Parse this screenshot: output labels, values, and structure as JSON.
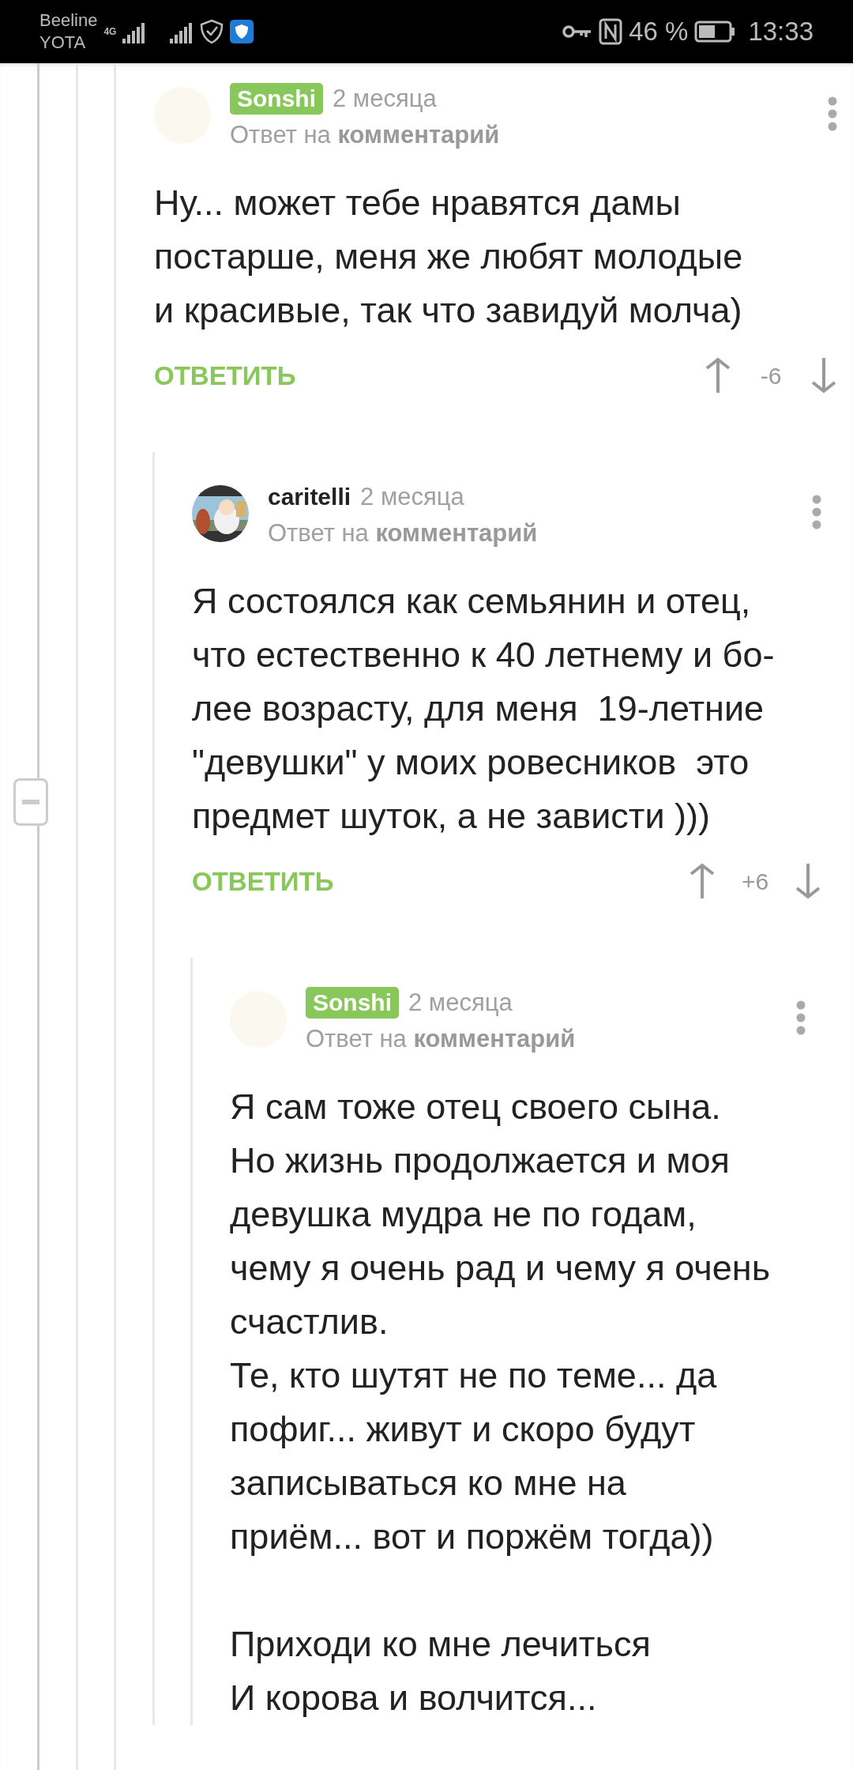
{
  "status_bar": {
    "carrier_top": "Beeline",
    "carrier_bottom": "YOTA",
    "network": "4G",
    "battery": "46 %",
    "time": "13:33"
  },
  "thread": {
    "expanded": true
  },
  "comment": {
    "author": "Sonshi",
    "author_badge": true,
    "avatar": {
      "kind": "blank"
    },
    "time": "2 месяца",
    "reply_to": "Ответ на **комментарий**",
    "body": "Ну... может тебе нравятся дамы\nпостарше, меня же любят молодые\nи красивые, так что завидуй молча)",
    "reply_label": "ОТВЕТИТЬ",
    "score": "-6",
    "children": [
      {
        "author": "caritelli",
        "author_badge": false,
        "time": "2 месяца",
        "reply_to": "Ответ на **комментарий**",
        "body": "Я состоялся как семьянин и отец,\nчто естественно к 40 летнему и бо-\nлее возрасту, для меня  19-летние\n\"девушки\" у моих ровесников  это\nпредмет шуток, а не зависти )))",
        "reply_label": "ОТВЕТИТЬ",
        "score": "+6",
        "children": [
          {
            "author": "Sonshi",
            "author_badge": true,
            "avatar": {
              "kind": "blank"
            },
            "time": "2 месяца",
            "reply_to": "Ответ на **комментарий**",
            "body": "Я сам тоже отец своего сына.\nНо жизнь продолжается и моя\nдевушка мудра не по годам,\nчему я очень рад и чему я очень\nсчастлив.\nТе, кто шутят не по теме... да\nпофиг... живут и скоро будут\nзаписываться ко мне на\nприём... вот и поржём тогда))\n\nПриходи ко мне лечиться\nИ корова и волчится..."
          }
        ]
      }
    ]
  }
}
